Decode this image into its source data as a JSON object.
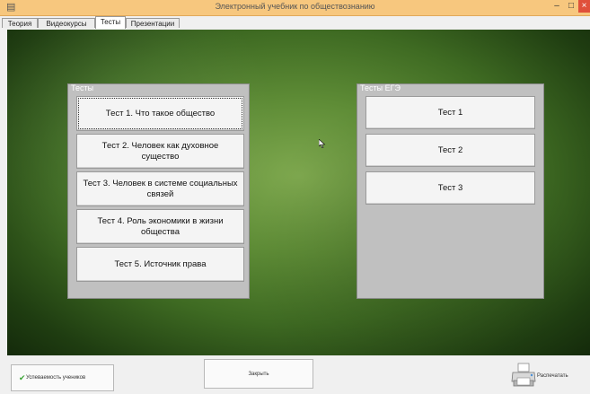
{
  "window": {
    "title": "Электронный учебник по обществознанию",
    "app_icon": "app-icon",
    "minimize_glyph": "–",
    "maximize_glyph": "□",
    "close_glyph": "×"
  },
  "tabs": [
    {
      "label": "Теория"
    },
    {
      "label": "Видеокурсы"
    },
    {
      "label": "Тесты",
      "active": true
    },
    {
      "label": "Презентации"
    }
  ],
  "tests_panel": {
    "title": "Тесты",
    "buttons": [
      {
        "label": "Тест 1. Что такое общество"
      },
      {
        "label": "Тест 2. Человек как духовное существо"
      },
      {
        "label": "Тест 3. Человек в системе социальных связей"
      },
      {
        "label": "Тест 4. Роль экономики в жизни общества"
      },
      {
        "label": "Тест 5. Источник права"
      }
    ]
  },
  "ege_panel": {
    "title": "Тесты ЕГЭ",
    "buttons": [
      {
        "label": "Тест 1"
      },
      {
        "label": "Тест 2"
      },
      {
        "label": "Тест 3"
      }
    ]
  },
  "bottom": {
    "progress_label": "Успеваемость учеников",
    "close_label": "Закрыть",
    "print_label": "Распечатать"
  },
  "colors": {
    "titlebar": "#f7c77e",
    "board_center": "#7fa94f",
    "board_edge": "#142a0b",
    "panel": "#c0c0c0",
    "close_button": "#e0503a",
    "check": "#3aa335"
  }
}
